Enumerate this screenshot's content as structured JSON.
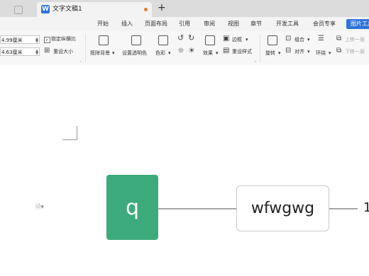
{
  "tabs": {
    "active_label": "文字文稿1",
    "add_symbol": "+"
  },
  "menu": {
    "items": [
      "开始",
      "插入",
      "页面布局",
      "引用",
      "审阅",
      "视图",
      "章节",
      "开发工具",
      "会员专享"
    ],
    "active": "图片工具"
  },
  "ribbon": {
    "height_value": "4.99厘米",
    "width_value": "4.63厘米",
    "lock_ratio": "锁定纵横比",
    "reset_size": "重设大小",
    "remove_bg": "抠除背景",
    "set_transparent": "设置透明色",
    "color": "色彩",
    "effects": "效果",
    "border": "边框",
    "reset_style": "重设样式",
    "rotate": "旋转",
    "combine": "组合",
    "align": "对齐",
    "wrap": "环绕",
    "bring_forward": "上移一层",
    "send_backward": "下移一层"
  },
  "diagram": {
    "node1": "q",
    "node2": "wfwgwg",
    "node3": "1"
  },
  "colors": {
    "accent": "#2f73d8",
    "node_green": "#3daa7c"
  }
}
